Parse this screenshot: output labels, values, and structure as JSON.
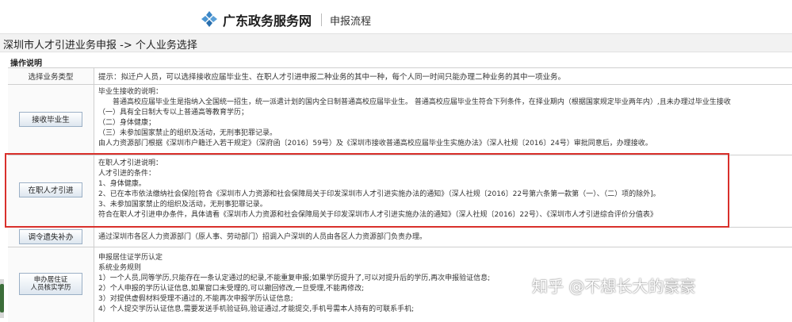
{
  "header": {
    "site_title": "广东政务服务网",
    "subtitle": "申报流程"
  },
  "breadcrumb": "深圳市人才引进业务申报 -> 个人业务选择",
  "section_title": "操作说明",
  "table": {
    "header_label": "选择业务类型",
    "header_hint": "提示：拟迁户人员，可以选择接收应届毕业生、在职人才引进申报二种业务的其中一种，每个人同一时间只能办理二种业务的其中一项业务。",
    "rows": [
      {
        "button": "接收毕业生",
        "lines": [
          "毕业生接收的说明：",
          "　　普通高校应届毕业生是指纳入全国统一招生，统一派遣计划的国内全日制普通高校应届毕业生。 普通高校应届毕业生符合下列条件，在择业期内（根据国家规定毕业两年内）,且未办理过毕业生接收",
          "（一）具有全日制大专以上普通高等教育学历；",
          "（二）身体健康；",
          "（三）未参加国家禁止的组织及活动，无刑事犯罪记录。",
          "由人力资源部门根据《深圳市户籍迁入若干规定》（深府函〔2016〕59号）及《深圳市接收普通高校应届毕业生实施办法》（深人社规〔2016〕24号）审批同意后，办理接收。"
        ]
      },
      {
        "button": "在职人才引进",
        "lines": [
          "在职人才引进说明：",
          "人才引进的条件：",
          "1、身体健康。",
          "2、已在本市依法缴纳社会保险[符合《深圳市人力资源和社会保障局关于印发深圳市人才引进实施办法的通知》（深人社规〔2016〕22号第六条第一款第（一）、（二）项的除外]。",
          "3、未参加国家禁止的组织及活动，无刑事犯罪记录。",
          "符合在职人才引进申办条件，具体请看《深圳市人力资源和社会保障局关于印发深圳市人才引进实施办法的通知》（深人社规〔2016〕22号）、《深圳市人才引进综合评价分值表》"
        ]
      },
      {
        "button": "调令遗失补办",
        "lines": [
          "通过深圳市各区人力资源部门（原人事、劳动部门）招调入户深圳的人员由各区人力资源部门负责办理。"
        ]
      },
      {
        "button_line1": "申办居住证",
        "button_line2": "人员核实学历",
        "lines": [
          "申报居住证学历认定",
          "系统业务规则",
          "1）一个人员,同等学历,只能存在一条认定通过的纪录,不能重复申报;如果学历提升了,可以对提升后的学历,再次申报验证信息;",
          "2）个人申报的学历认证信息,如果窗口未受理的,可以撤回修改,一旦受理,不能再修改;",
          "3）对提供虚假材料受理不通过的,不能再次申报学历认证信息;",
          "4）个人提交学历认证信息,需要发送手机验证码,验证通过,才能提交,手机号需本人持有的可联系手机;"
        ]
      }
    ]
  },
  "watermark": "知乎 @不想长大的豪豪",
  "colors": {
    "highlight": "#d9302b",
    "logo": "#3b86c6"
  }
}
